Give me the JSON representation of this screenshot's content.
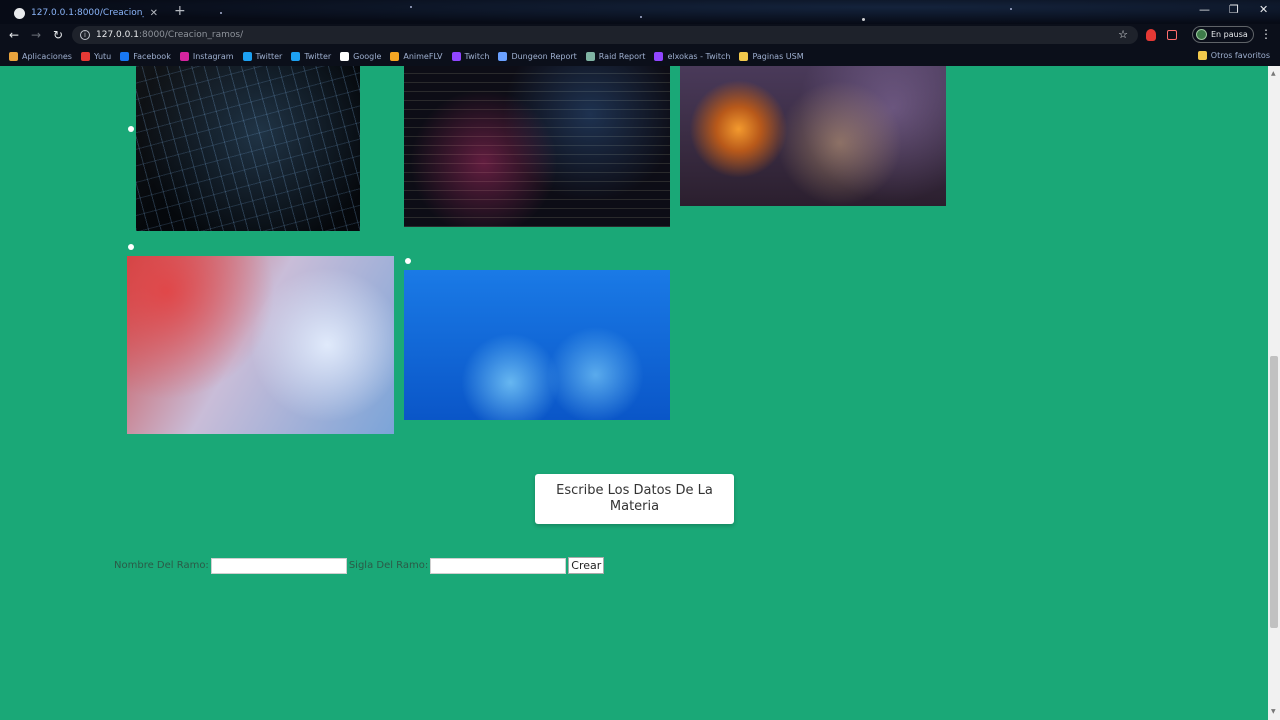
{
  "browser": {
    "tab_title": "127.0.0.1:8000/Creacion_ramos/",
    "url_host": "127.0.0.1",
    "url_rest": ":8000/Creacion_ramos/",
    "profile_label": "En pausa",
    "bookmarks": [
      {
        "label": "Aplicaciones",
        "color": "#e8a33d"
      },
      {
        "label": "Yutu",
        "color": "#e53935"
      },
      {
        "label": "Facebook",
        "color": "#1877f2"
      },
      {
        "label": "Instagram",
        "color": "#d6249f"
      },
      {
        "label": "Twitter",
        "color": "#1da1f2"
      },
      {
        "label": "Twitter",
        "color": "#1da1f2"
      },
      {
        "label": "Google",
        "color": "#ffffff"
      },
      {
        "label": "AnimeFLV",
        "color": "#f5a623"
      },
      {
        "label": "Twitch",
        "color": "#9146ff"
      },
      {
        "label": "Dungeon Report",
        "color": "#6aa0ff"
      },
      {
        "label": "Raid Report",
        "color": "#7fb3a3"
      },
      {
        "label": "elxokas - Twitch",
        "color": "#9146ff"
      },
      {
        "label": "Paginas USM",
        "color": "#f2c94c"
      }
    ],
    "other_bookmarks": "Otros favoritos"
  },
  "page": {
    "header_text": "Escribe Los Datos De La Materia",
    "form": {
      "name_label": "Nombre Del Ramo:",
      "name_value": "",
      "sigla_label": "Sigla Del Ramo:",
      "sigla_value": "",
      "submit_label": "Crear"
    }
  }
}
